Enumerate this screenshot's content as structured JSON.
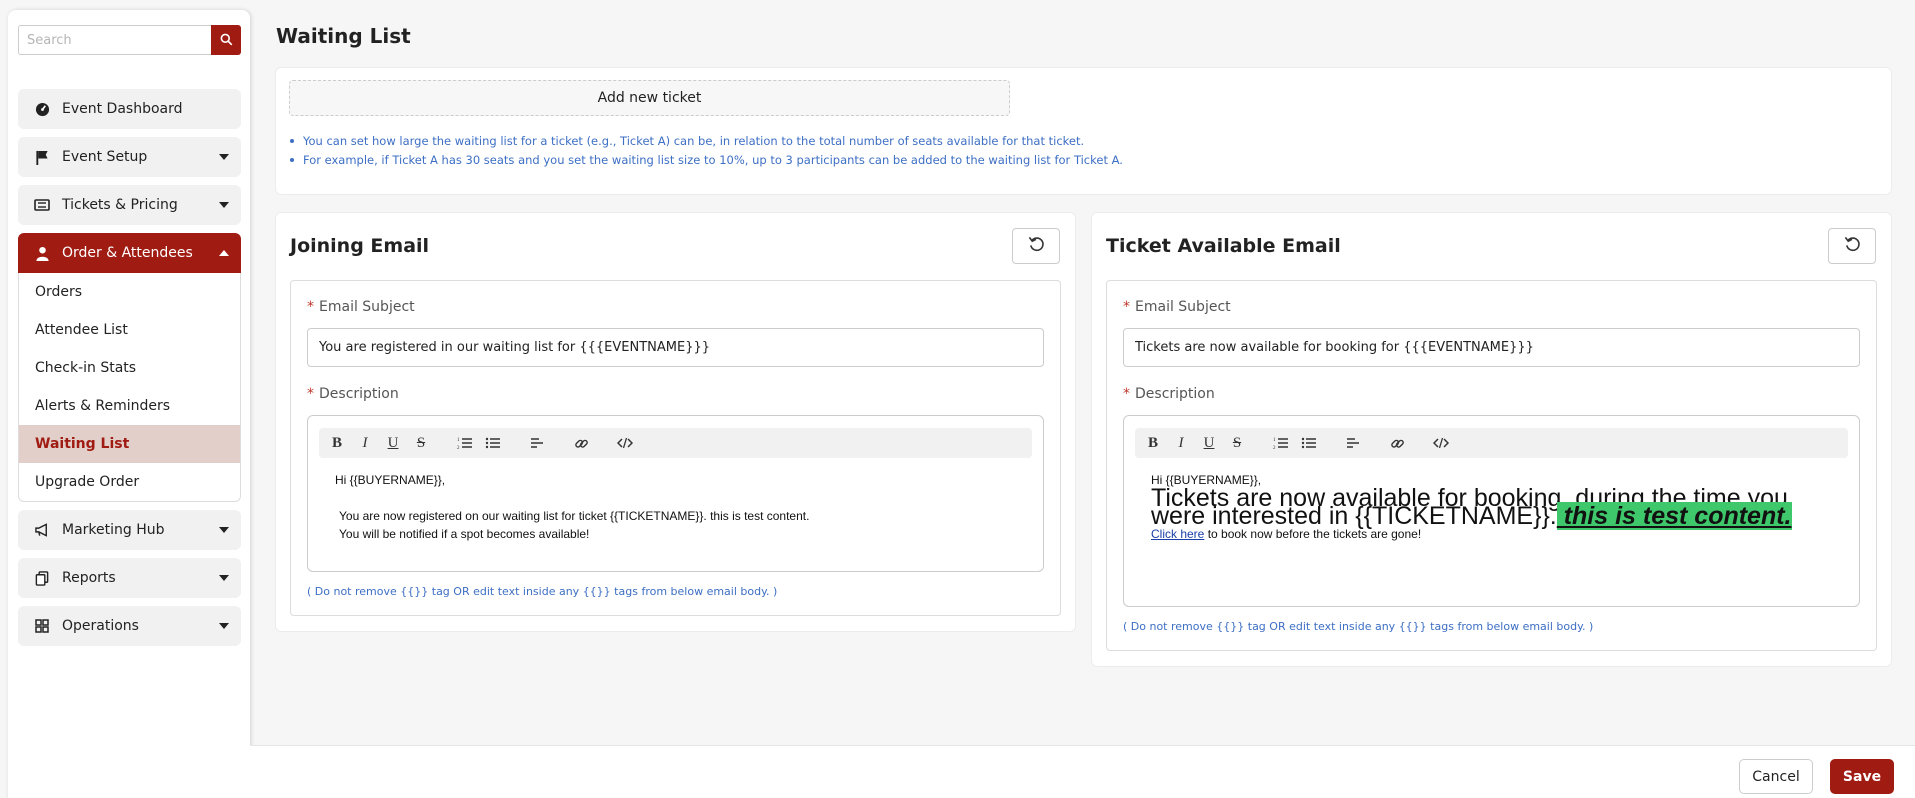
{
  "sidebar": {
    "search_placeholder": "Search",
    "items": [
      {
        "label": "Event Dashboard",
        "icon": "dashboard-icon"
      },
      {
        "label": "Event Setup",
        "icon": "flag-icon"
      },
      {
        "label": "Tickets & Pricing",
        "icon": "ticket-icon"
      },
      {
        "label": "Order & Attendees",
        "icon": "user-icon"
      },
      {
        "label": "Marketing Hub",
        "icon": "megaphone-icon"
      },
      {
        "label": "Reports",
        "icon": "reports-icon"
      },
      {
        "label": "Operations",
        "icon": "grid-icon"
      }
    ],
    "sub_items": [
      "Orders",
      "Attendee List",
      "Check-in Stats",
      "Alerts & Reminders",
      "Waiting List",
      "Upgrade Order"
    ],
    "selected_sub_item": "Waiting List",
    "accent": "#a01b12"
  },
  "page": {
    "title": "Waiting List",
    "add_ticket": "Add new ticket",
    "info": [
      "You can set how large the waiting list for a ticket (e.g., Ticket A) can be, in relation to the total number of seats available for that ticket.",
      "For example, if Ticket A has 30 seats and you set the waiting list size to 10%, up to 3 participants can be added to the waiting list for Ticket A."
    ]
  },
  "joining_email": {
    "title": "Joining Email",
    "subject_label": "Email Subject",
    "subject_value": "You are registered in our waiting list for {{{EVENTNAME}}}",
    "description_label": "Description",
    "body_greeting": "Hi {{BUYERNAME}},",
    "body_line1": "You are now registered on our waiting list for ticket {{TICKETNAME}}. this is test content.",
    "body_line2": "You will be notified if a spot becomes available!",
    "note": "( Do not remove {{}} tag OR edit text inside any {{}} tags from below email body. )"
  },
  "ticket_email": {
    "title": "Ticket Available Email",
    "subject_label": "Email Subject",
    "subject_value": "Tickets are now available for booking for {{{EVENTNAME}}}",
    "description_label": "Description",
    "body_greeting": "Hi {{BUYERNAME}},",
    "body_big": "Tickets are now available for booking, during the time you were interested in {{TICKETNAME}}.",
    "body_highlight": " this is test content.",
    "body_link": "Click here",
    "body_tail": " to book now before the tickets are gone!",
    "highlight_color": "#3fc86b",
    "note": "( Do not remove {{}} tag OR edit text inside any {{}} tags from below email body. )"
  },
  "footer": {
    "cancel": "Cancel",
    "save": "Save"
  }
}
